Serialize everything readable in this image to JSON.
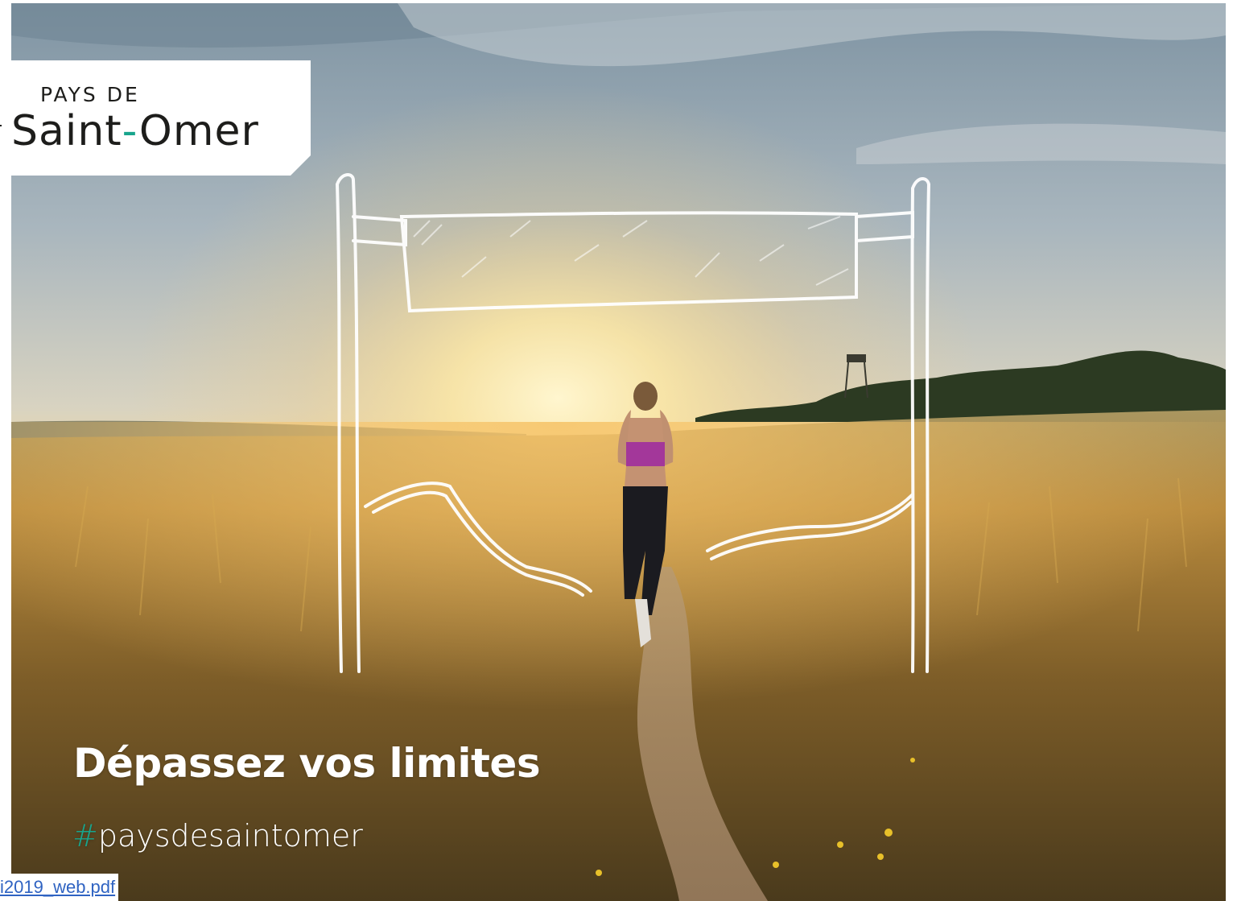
{
  "logo": {
    "line1": "PAYS DE",
    "line2_part1": "Saint",
    "line2_dash": "-",
    "line2_part2": "Omer"
  },
  "headline": "Dépassez vos limites",
  "hashtag": {
    "symbol": "#",
    "text": "paysdesaintomer"
  },
  "file_link": {
    "label": "i2019_web.pdf"
  },
  "colors": {
    "brand_green": "#18a58d",
    "link_blue": "#2f63c2"
  }
}
